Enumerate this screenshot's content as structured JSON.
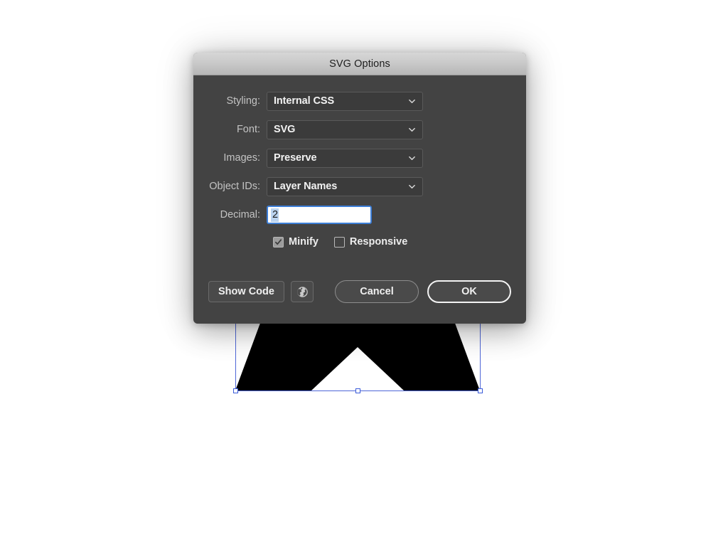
{
  "dialog": {
    "title": "SVG Options",
    "rows": [
      {
        "label": "Styling:",
        "value": "Internal CSS",
        "control": "select"
      },
      {
        "label": "Font:",
        "value": "SVG",
        "control": "select"
      },
      {
        "label": "Images:",
        "value": "Preserve",
        "control": "select"
      },
      {
        "label": "Object IDs:",
        "value": "Layer Names",
        "control": "select"
      },
      {
        "label": "Decimal:",
        "value": "2",
        "control": "text"
      }
    ],
    "checkboxes": [
      {
        "label": "Minify",
        "checked": true
      },
      {
        "label": "Responsive",
        "checked": false
      }
    ],
    "buttons": {
      "show_code": "Show Code",
      "preview_icon": "globe-icon",
      "cancel": "Cancel",
      "ok": "OK"
    }
  },
  "canvas": {
    "artwork_name": "black-star-shape",
    "artwork_fill": "#000000",
    "selection_color": "#4f67d8",
    "handle_fill": "#ffffff"
  },
  "colors": {
    "dialog_bg": "#434343",
    "titlebar_top": "#d6d6d6",
    "titlebar_bottom": "#b6b6b6",
    "label_text": "#c3c3c3",
    "value_text": "#f2f2f2",
    "input_focus_border": "#3d7fd8",
    "input_selection": "#bcd4f0",
    "page_bg": "#ffffff"
  }
}
